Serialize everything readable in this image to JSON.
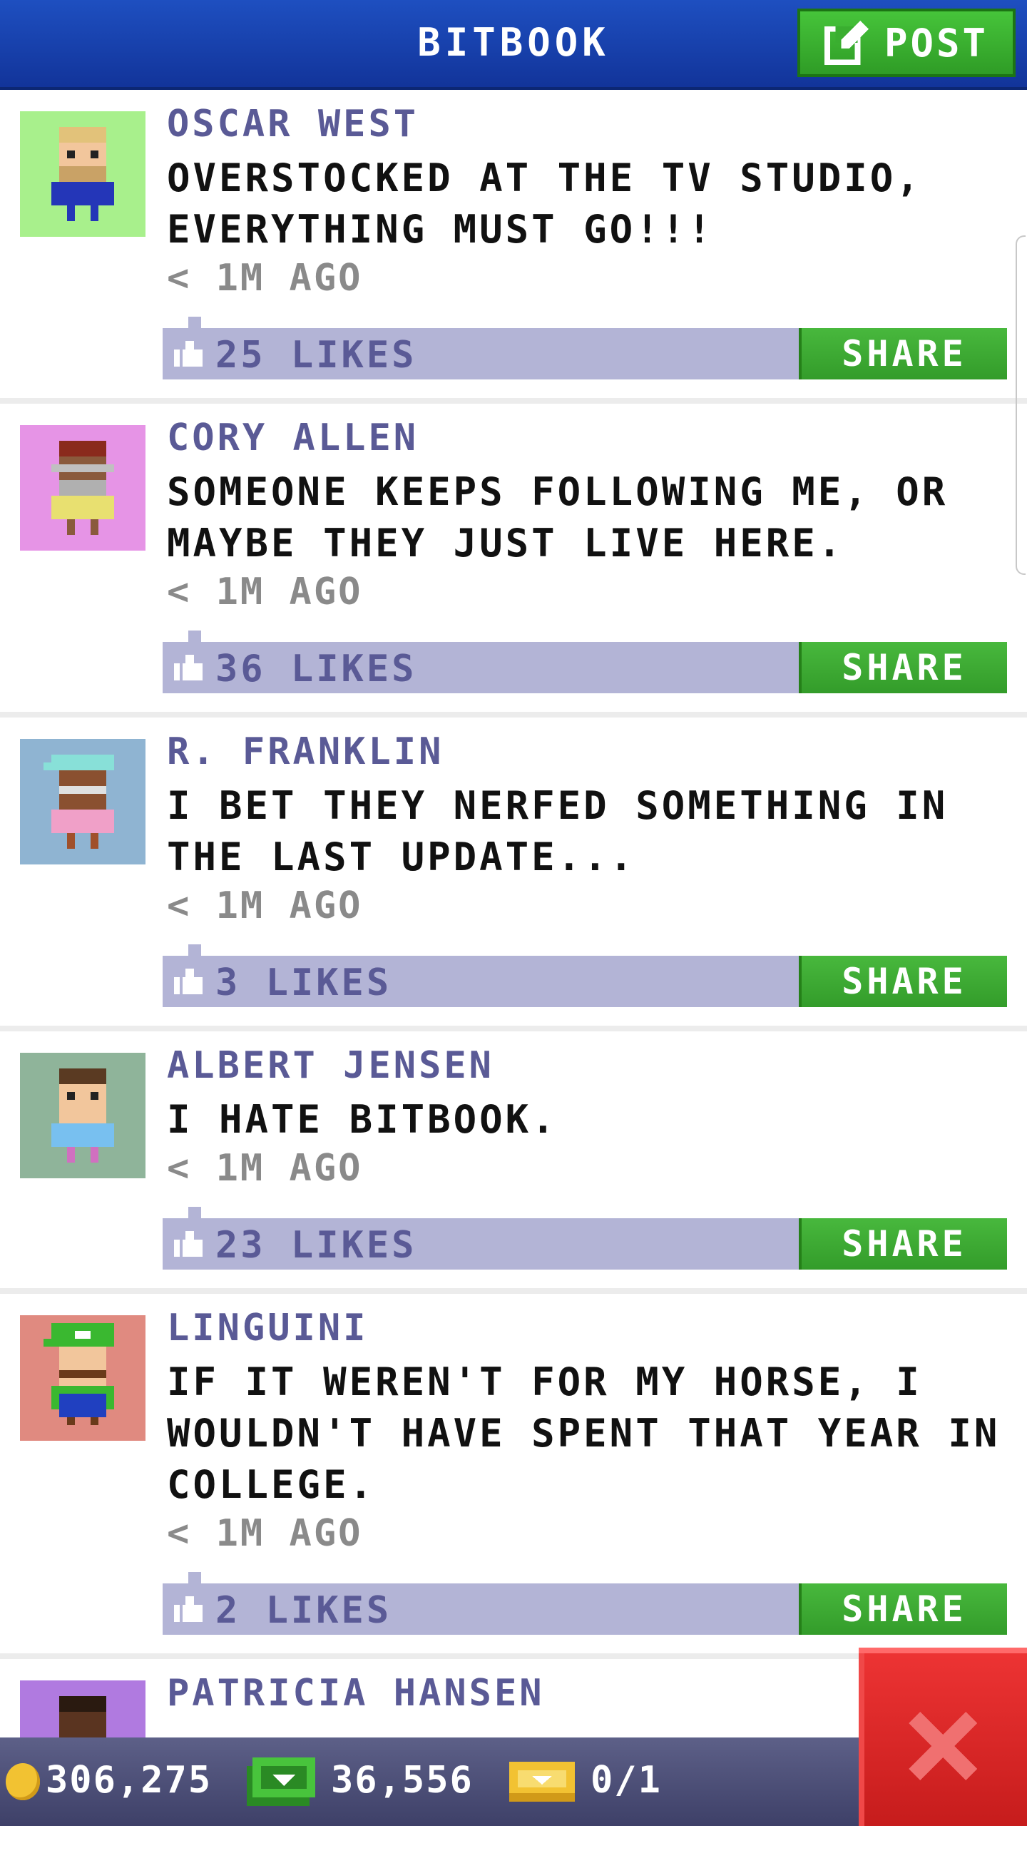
{
  "header": {
    "title": "BITBOOK",
    "post_label": "POST"
  },
  "posts": [
    {
      "author": "OSCAR WEST",
      "message": "OVERSTOCKED AT THE TV STUDIO, EVERYTHING MUST GO!!!",
      "time": "< 1M AGO",
      "likes": "25 LIKES",
      "share": "SHARE"
    },
    {
      "author": "CORY ALLEN",
      "message": "SOMEONE KEEPS FOLLOWING ME, OR MAYBE THEY JUST LIVE HERE.",
      "time": "< 1M AGO",
      "likes": "36 LIKES",
      "share": "SHARE"
    },
    {
      "author": "R. FRANKLIN",
      "message": "I BET THEY NERFED SOMETHING IN THE LAST UPDATE...",
      "time": "< 1M AGO",
      "likes": "3 LIKES",
      "share": "SHARE"
    },
    {
      "author": "ALBERT JENSEN",
      "message": "I HATE BITBOOK.",
      "time": "< 1M AGO",
      "likes": "23 LIKES",
      "share": "SHARE"
    },
    {
      "author": "LINGUINI",
      "message": "IF IT WEREN'T FOR MY HORSE, I WOULDN'T HAVE SPENT THAT YEAR IN COLLEGE.",
      "time": "< 1M AGO",
      "likes": "2 LIKES",
      "share": "SHARE"
    },
    {
      "author": "PATRICIA HANSEN"
    }
  ],
  "status_bar": {
    "coins": "306,275",
    "bux": "36,556",
    "tickets": "0/1"
  },
  "icons": {
    "post": "edit-icon",
    "like": "thumbs-up-icon",
    "coin": "coin-icon",
    "bux": "bux-icon",
    "ticket": "ticket-icon",
    "close": "close-icon"
  },
  "colors": {
    "header": "#1e4fc0",
    "accent_green": "#3fae33",
    "like_bar": "#b3b4d6",
    "author": "#5a5a96",
    "close": "#e02828"
  }
}
